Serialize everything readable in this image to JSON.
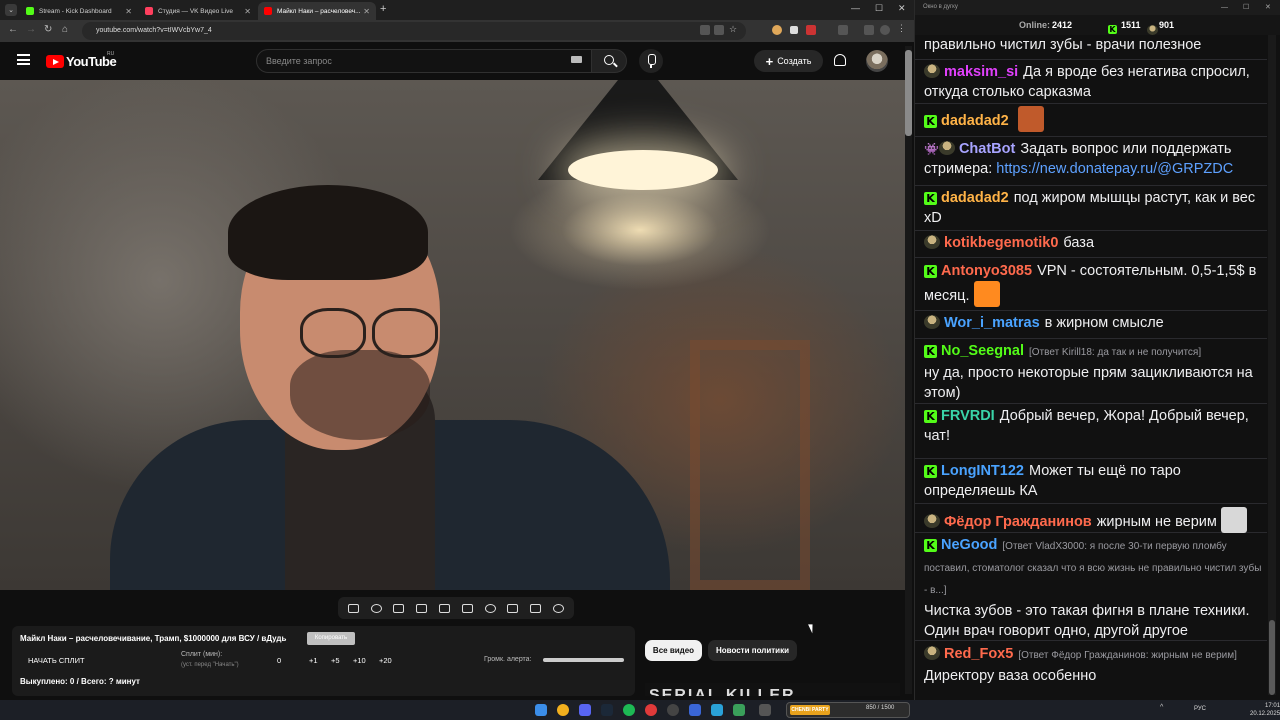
{
  "browser": {
    "tabs": [
      {
        "title": "Stream - Kick Dashboard",
        "favicon_color": "#53fc18"
      },
      {
        "title": "Студия — VK Видео Live",
        "favicon_color": "#ff3f5e"
      },
      {
        "title": "Майкл Наки – расчеловеч...",
        "favicon_color": "#ff0000"
      }
    ],
    "url": "youtube.com/watch?v=tIWVcbYw7_4",
    "extension_badge": "312"
  },
  "youtube": {
    "logo_text": "YouTube",
    "region": "RU",
    "search_placeholder": "Введите запрос",
    "create_label": "Создать"
  },
  "extension_panel": {
    "video_title": "Майкл Наки – расчеловечивание, Трамп, $1000000 для ВСУ / вДудь",
    "copy_label": "Копировать",
    "start_split_label": "НАЧАТЬ СПЛИТ",
    "split_label": "Сплит (мин):",
    "split_hint": "(уст. перед \"Начать\")",
    "split_values": [
      "0",
      "+1",
      "+5",
      "+10",
      "+20"
    ],
    "alert_volume_label": "Громк. алерта:",
    "alert_volume": 1.0,
    "bought_text": "Выкуплено: 0 / Всего: ? минут"
  },
  "chips": {
    "all_videos": "Все видео",
    "politics_news": "Новости политики"
  },
  "thumbnail_text": "SERIAL KILLER",
  "chat": {
    "window_title": "Окно в дугку",
    "online_label": "Online:",
    "online_count": "2412",
    "kick_count": "1511",
    "vk_count": "901",
    "messages": [
      {
        "platform": "none",
        "user": "",
        "user_color": "#efeff1",
        "reply": "",
        "text": "правильно чистил зубы - врачи полезное"
      },
      {
        "platform": "vk",
        "user": "maksim_si",
        "user_color": "#e040fb",
        "reply": "",
        "text": "Да я вроде без негатива спросил, откуда столько сарказма"
      },
      {
        "platform": "kick",
        "user": "dadadad2",
        "user_color": "#ffb347",
        "reply": "",
        "text": "",
        "emote": "laughing-face-emote"
      },
      {
        "platform": "bot",
        "user": "ChatBot",
        "user_color": "#a8a4ff",
        "reply": "",
        "text": "Задать вопрос или поддержать стримера:",
        "link": "https://new.donatepay.ru/@GRPZDC"
      },
      {
        "platform": "kick",
        "user": "dadadad2",
        "user_color": "#ffb347",
        "reply": "",
        "text": "под жиром мышцы растут, как и вес xD"
      },
      {
        "platform": "vk",
        "user": "kotikbegemotik0",
        "user_color": "#ff6a4d",
        "reply": "",
        "text": "база"
      },
      {
        "platform": "kick",
        "user": "Antonyo3085",
        "user_color": "#ff6a4d",
        "reply": "",
        "text": "VPN - состоятельным. 0,5-1,5$ в месяц.",
        "emote": "fire-emote"
      },
      {
        "platform": "vk",
        "user": "Wor_i_matras",
        "user_color": "#4aa3ff",
        "reply": "",
        "text": "в жирном смысле"
      },
      {
        "platform": "kick",
        "user": "No_Seegnal",
        "user_color": "#53fc18",
        "reply": "[Ответ Kirill18: да так и не получится]",
        "text": "ну да, просто некоторые прям зацикливаются на этом)"
      },
      {
        "platform": "kick",
        "user": "FRVRDI",
        "user_color": "#3ad4a8",
        "reply": "",
        "text": "Добрый вечер, Жора! Добрый вечер, чат!"
      },
      {
        "platform": "kick",
        "user": "LongINT122",
        "user_color": "#4aa3ff",
        "reply": "",
        "text": "Может ты ещё по таро определяешь КА"
      },
      {
        "platform": "vk",
        "user": "Фёдор Гражданинов",
        "user_color": "#ff6a4d",
        "reply": "",
        "text": "жирным не верим",
        "emote": "meme-face-emote"
      },
      {
        "platform": "kick",
        "user": "NeGood",
        "user_color": "#4aa3ff",
        "reply": "[Ответ VladX3000: я после 30-ти первую пломбу поставил, стоматолог сказал что я всю жизнь не правильно чистил зубы - в...]",
        "text": "Чистка зубов - это такая фигня в плане техники. Один врач говорит одно, другой другое"
      },
      {
        "platform": "vk",
        "user": "Red_Fox5",
        "user_color": "#ff6a4d",
        "reply": "[Ответ Фёдор Гражданинов: жирным не верим]",
        "text": "Директору ваза особенно"
      }
    ]
  },
  "taskbar": {
    "widget_label": "CHENBI PARTY",
    "widget_value": "850 / 1500",
    "lang": "РУС",
    "time": "17:01",
    "date": "20.12.2025"
  }
}
